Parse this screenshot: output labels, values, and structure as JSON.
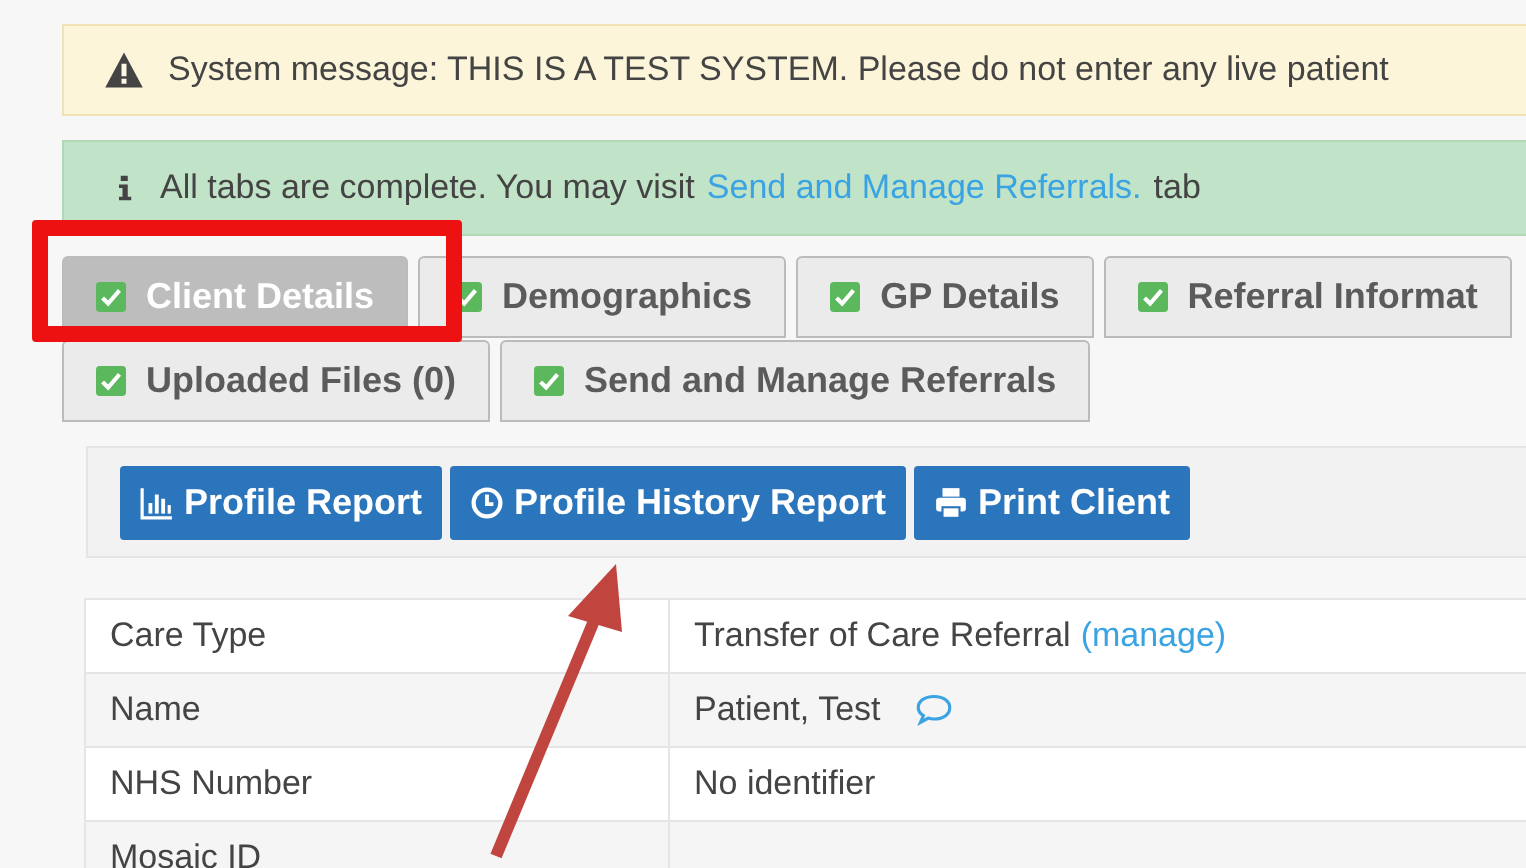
{
  "alerts": [
    {
      "kind": "warning",
      "text": "System message: THIS IS A TEST SYSTEM. Please do not enter any live patient"
    },
    {
      "kind": "info",
      "text": "All tabs are complete. You may visit",
      "link": "Send and Manage Referrals.",
      "suffix": "tab"
    }
  ],
  "tab_rows": [
    [
      {
        "label": "Client Details",
        "selected": true,
        "complete": true
      },
      {
        "label": "Demographics",
        "selected": false,
        "complete": true
      },
      {
        "label": "GP Details",
        "selected": false,
        "complete": true
      },
      {
        "label": "Referral Informat",
        "selected": false,
        "complete": true
      }
    ],
    [
      {
        "label": "Uploaded Files (0)",
        "selected": false,
        "complete": true
      },
      {
        "label": "Send and Manage Referrals",
        "selected": false,
        "complete": true
      }
    ]
  ],
  "buttons": [
    {
      "label": "Profile Report"
    },
    {
      "label": "Profile History Report"
    },
    {
      "label": "Print Client"
    }
  ],
  "details": [
    {
      "label": "Care Type",
      "value": "Transfer of Care Referral",
      "link": "(manage)"
    },
    {
      "label": "Name",
      "value": "Patient, Test",
      "comment": true
    },
    {
      "label": "NHS Number",
      "value": "No identifier"
    },
    {
      "label": "Mosaic ID"
    }
  ]
}
